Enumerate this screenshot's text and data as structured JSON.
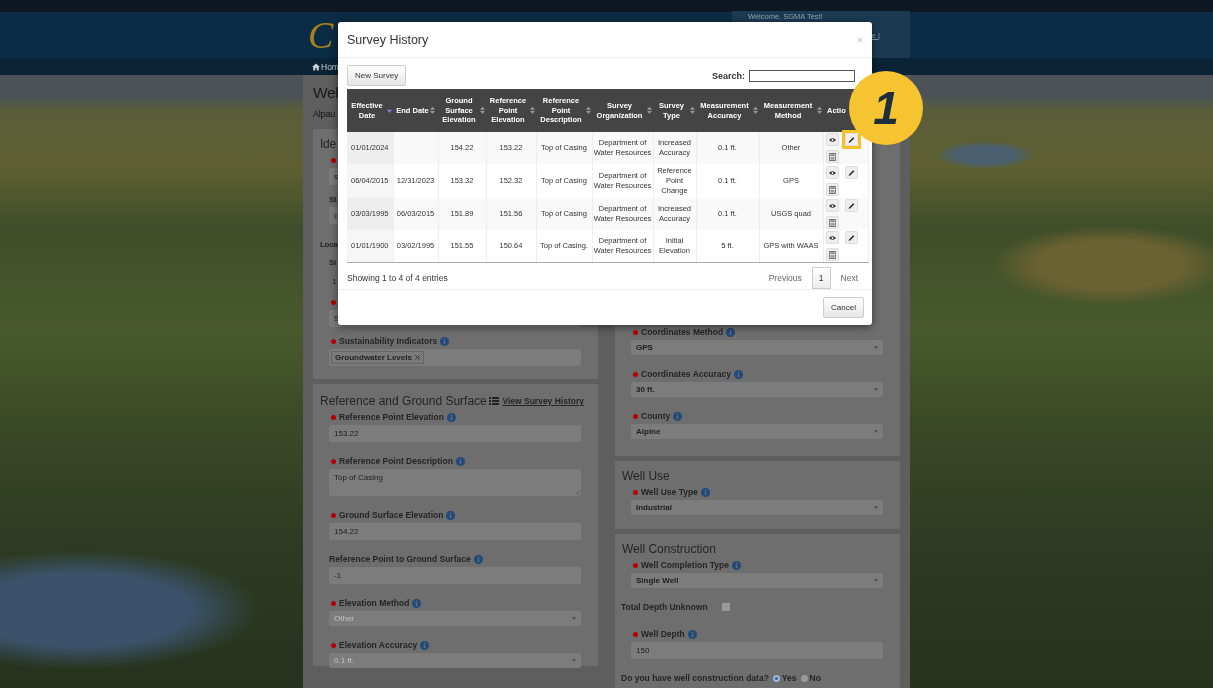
{
  "header": {
    "logo": "C",
    "welcome": "Welcome, SGMA Test!",
    "welcome_tail": "e |",
    "home_link": "Hom"
  },
  "page": {
    "title": "Wel",
    "subtitle": "Alpau"
  },
  "form": {
    "left": [
      {
        "heading": "Ide",
        "items": [
          {
            "kind": "input",
            "required": true,
            "info": false,
            "value": "s"
          },
          {
            "kind": "input",
            "required": false,
            "info": false,
            "label": "St",
            "value": "c"
          },
          {
            "kind": "subheading",
            "text": "Loca"
          },
          {
            "kind": "text",
            "required": false,
            "info": false,
            "label": "Si",
            "value": "1"
          },
          {
            "kind": "input",
            "required": true,
            "info": false,
            "value": "S"
          },
          {
            "kind": "tags",
            "required": true,
            "info": true,
            "label": "Sustainability Indicators",
            "tags": [
              "Groundwater Levels"
            ]
          }
        ]
      },
      {
        "heading": "Reference and Ground Surface",
        "link": "View Survey History",
        "items": [
          {
            "kind": "input",
            "required": true,
            "info": true,
            "label": "Reference Point Elevation",
            "value": "153.22"
          },
          {
            "kind": "textarea",
            "required": true,
            "info": true,
            "label": "Reference Point Description",
            "value": "Top of Casing"
          },
          {
            "kind": "input",
            "required": true,
            "info": true,
            "label": "Ground Surface Elevation",
            "value": "154.22"
          },
          {
            "kind": "input",
            "required": false,
            "info": true,
            "label": "Reference Point to Ground Surface",
            "value": "-1"
          },
          {
            "kind": "select",
            "required": true,
            "info": true,
            "label": "Elevation Method",
            "value": "Other",
            "disabled": true
          },
          {
            "kind": "select",
            "required": true,
            "info": true,
            "label": "Elevation Accuracy",
            "value": "0.1 ft.",
            "disabled": true
          }
        ]
      }
    ],
    "right": [
      {
        "items": [
          {
            "kind": "select",
            "required": true,
            "info": true,
            "label": "Coordinates Method",
            "value": "GPS",
            "disabled": false
          },
          {
            "kind": "select",
            "required": true,
            "info": true,
            "label": "Coordinates Accuracy",
            "value": "30 ft.",
            "disabled": false
          },
          {
            "kind": "select",
            "required": true,
            "info": true,
            "label": "County",
            "value": "Alpine",
            "disabled": false
          }
        ]
      },
      {
        "heading": "Well Use",
        "items": [
          {
            "kind": "select",
            "required": true,
            "info": true,
            "label": "Well Use Type",
            "value": "Industrial",
            "disabled": false
          }
        ]
      },
      {
        "heading": "Well Construction",
        "items": [
          {
            "kind": "select",
            "required": true,
            "info": true,
            "label": "Well Completion Type",
            "value": "Single Well",
            "disabled": false
          },
          {
            "kind": "checkbox",
            "label": "Total Depth Unknown",
            "checked": false
          },
          {
            "kind": "input",
            "required": true,
            "info": true,
            "label": "Well Depth",
            "value": "150"
          },
          {
            "kind": "radio",
            "label": "Do you have well construction data?",
            "options": [
              {
                "label": "Yes",
                "selected": true
              },
              {
                "label": "No",
                "selected": false
              }
            ]
          }
        ]
      }
    ]
  },
  "modal": {
    "title": "Survey History",
    "new_button": "New Survey",
    "search_label": "Search:",
    "columns": [
      {
        "label": "Effective Date",
        "sortable": true,
        "sorted": true
      },
      {
        "label": "End Date",
        "sortable": true,
        "sorted": false
      },
      {
        "label": "Ground Surface Elevation",
        "sortable": true,
        "sorted": false
      },
      {
        "label": "Reference Point Elevation",
        "sortable": true,
        "sorted": false
      },
      {
        "label": "Reference Point Description",
        "sortable": true,
        "sorted": false
      },
      {
        "label": "Survey Organization",
        "sortable": true,
        "sorted": false
      },
      {
        "label": "Survey Type",
        "sortable": true,
        "sorted": false
      },
      {
        "label": "Measurement Accuracy",
        "sortable": true,
        "sorted": false
      },
      {
        "label": "Measurement Method",
        "sortable": true,
        "sorted": false
      },
      {
        "label": "Actio",
        "sortable": false,
        "sorted": false
      }
    ],
    "rows": [
      {
        "cells": [
          "01/01/2024",
          "",
          "154.22",
          "153.22",
          "Top of Casing",
          "Department of Water Resources",
          "Increased Accuracy",
          "0.1 ft.",
          "Other"
        ],
        "highlight": true
      },
      {
        "cells": [
          "06/04/2015",
          "12/31/2023",
          "153.32",
          "152.32",
          "Top of Casing",
          "Department of Water Resources",
          "Reference Point Change",
          "0.1 ft.",
          "GPS"
        ],
        "highlight": false
      },
      {
        "cells": [
          "03/03/1995",
          "06/03/2015",
          "151.89",
          "151.56",
          "Top of Casing",
          "Department of Water Resources",
          "Increased Accuracy",
          "0.1 ft.",
          "USGS quad"
        ],
        "highlight": false
      },
      {
        "cells": [
          "01/01/1900",
          "03/02/1995",
          "151.55",
          "150.64",
          "Top of Casing.",
          "Department of Water Resources",
          "Initial Elevation",
          "5 ft.",
          "GPS with WAAS"
        ],
        "highlight": false
      }
    ],
    "info": "Showing 1 to 4 of 4 entries",
    "pagination": {
      "previous": "Previous",
      "pages": [
        {
          "label": "1",
          "selected": true
        }
      ],
      "next": "Next"
    },
    "cancel": "Cancel"
  },
  "callout": {
    "number": "1"
  }
}
